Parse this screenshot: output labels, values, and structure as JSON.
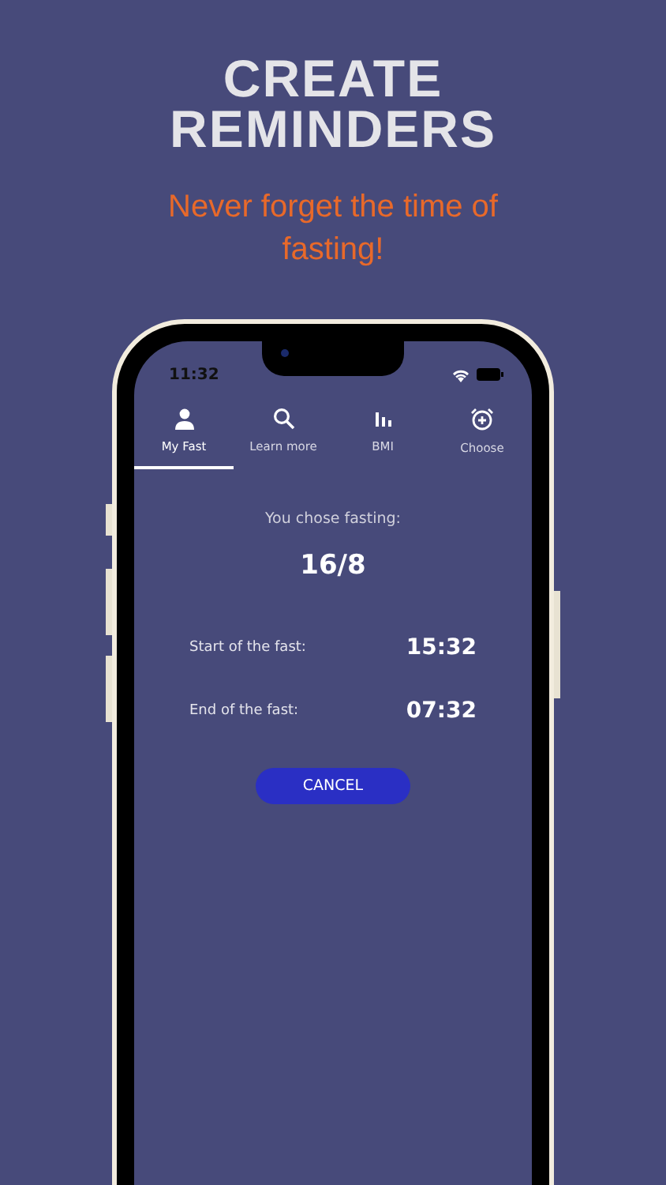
{
  "headline_lines": [
    "CREATE",
    "REMINDERS"
  ],
  "tagline": "Never forget the time of fasting!",
  "status_bar": {
    "time": "11:32"
  },
  "tabs": [
    {
      "label": "My Fast",
      "kind": "person",
      "selected": true
    },
    {
      "label": "Learn more",
      "kind": "search",
      "selected": false
    },
    {
      "label": "BMI",
      "kind": "chart",
      "selected": false
    },
    {
      "label": "Choose",
      "kind": "alarm",
      "selected": false
    }
  ],
  "content": {
    "prompt": "You chose fasting:",
    "plan": "16/8",
    "rows": [
      {
        "label": "Start of the fast:",
        "value": "15:32"
      },
      {
        "label": "End of the fast:",
        "value": "07:32"
      }
    ],
    "button": "CANCEL"
  }
}
